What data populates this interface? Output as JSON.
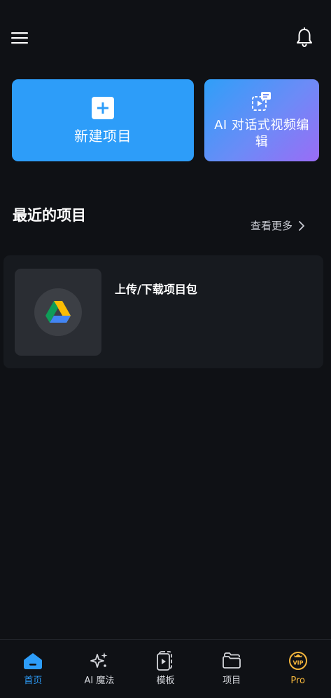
{
  "header": {
    "menu_icon": "hamburger-menu-icon",
    "notification_icon": "bell-icon"
  },
  "actions": {
    "new_project": {
      "label": "新建项目",
      "icon": "plus-icon",
      "color": "#2d9df9"
    },
    "ai_video_edit": {
      "label": "AI 对话式视频编辑",
      "icon": "chat-video-icon",
      "gradient": [
        "#2f9ff8",
        "#9a6cf6"
      ]
    }
  },
  "recent": {
    "title": "最近的项目",
    "see_more": "查看更多",
    "items": [
      {
        "name": "上传/下载项目包",
        "icon": "google-drive-icon"
      }
    ]
  },
  "bottom_nav": {
    "items": [
      {
        "label": "首页",
        "icon": "home-icon",
        "active": true
      },
      {
        "label": "AI 魔法",
        "icon": "sparkles-icon"
      },
      {
        "label": "模板",
        "icon": "template-icon"
      },
      {
        "label": "项目",
        "icon": "folder-icon"
      },
      {
        "label": "Pro",
        "icon": "vip-badge-icon",
        "color": "#f4b63c"
      }
    ]
  }
}
